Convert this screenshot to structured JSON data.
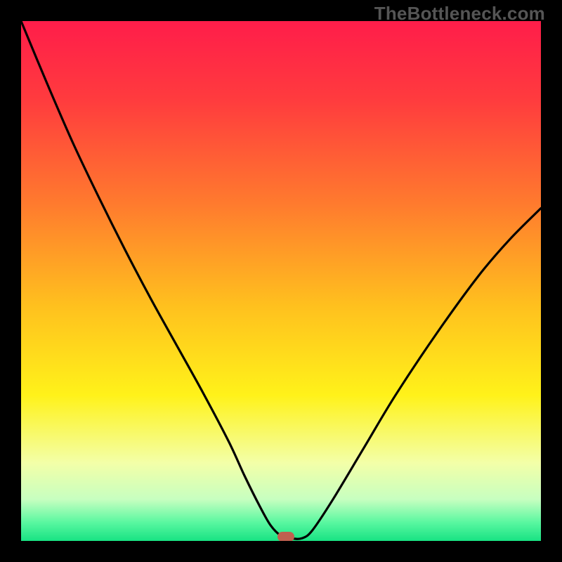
{
  "attribution": "TheBottleneck.com",
  "chart_data": {
    "type": "line",
    "title": "",
    "xlabel": "",
    "ylabel": "",
    "xlim": [
      0,
      100
    ],
    "ylim": [
      0,
      100
    ],
    "background_gradient_stops": [
      {
        "offset": 0.0,
        "color": "#ff1d4a"
      },
      {
        "offset": 0.15,
        "color": "#ff3b3e"
      },
      {
        "offset": 0.35,
        "color": "#ff7a2e"
      },
      {
        "offset": 0.55,
        "color": "#ffc11e"
      },
      {
        "offset": 0.72,
        "color": "#fff21a"
      },
      {
        "offset": 0.85,
        "color": "#f3ffa8"
      },
      {
        "offset": 0.92,
        "color": "#c7ffc0"
      },
      {
        "offset": 0.965,
        "color": "#58f7a0"
      },
      {
        "offset": 1.0,
        "color": "#18e283"
      }
    ],
    "series": [
      {
        "name": "bottleneck-curve",
        "x": [
          0.0,
          5,
          10,
          15,
          20,
          25,
          30,
          35,
          40,
          43,
          46,
          48,
          50,
          52,
          54,
          56,
          60,
          66,
          72,
          80,
          88,
          94,
          100
        ],
        "y": [
          100,
          88,
          76.5,
          66,
          56,
          46.5,
          37.5,
          28.5,
          19,
          12.5,
          6.5,
          3,
          1,
          0.5,
          0.5,
          2,
          8,
          18,
          28,
          40,
          51,
          58,
          64
        ]
      }
    ],
    "marker": {
      "x": 51,
      "y": 0.8,
      "color": "#c0604f"
    }
  }
}
